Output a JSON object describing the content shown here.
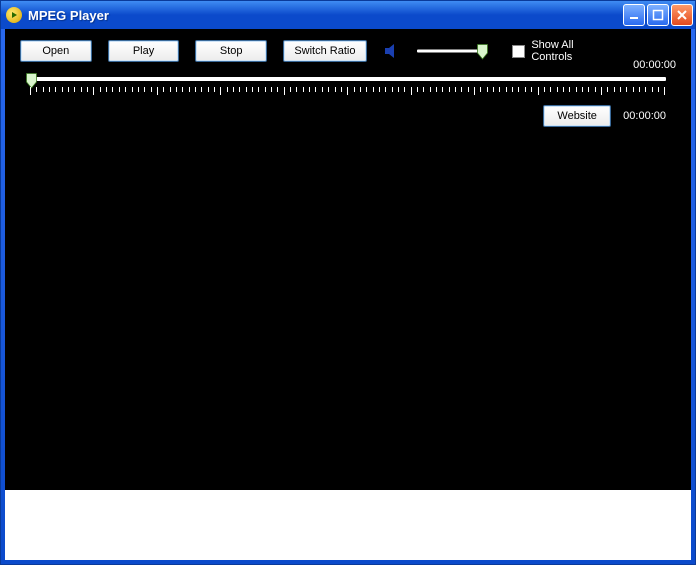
{
  "window": {
    "title": "MPEG Player"
  },
  "toolbar": {
    "open": "Open",
    "play": "Play",
    "stop": "Stop",
    "switch_ratio": "Switch Ratio",
    "show_all_controls": "Show All Controls",
    "website": "Website"
  },
  "time": {
    "top": "00:00:00",
    "bottom": "00:00:00"
  },
  "volume": {
    "value": 85,
    "max": 100
  },
  "seek": {
    "position": 0,
    "duration": 0
  }
}
